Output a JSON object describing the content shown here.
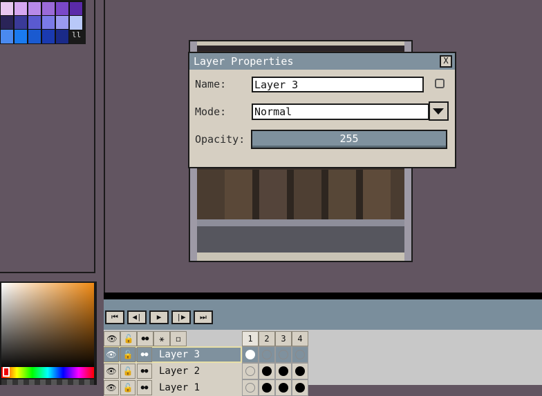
{
  "palette": {
    "colors": [
      [
        "#e8c8f0",
        "#d6a8f0",
        "#b88ae8",
        "#9a6ad8",
        "#7a48c8",
        "#5a2aa8"
      ],
      [
        "#2a2458",
        "#3a3a98",
        "#5a5ad0",
        "#7a7ae8",
        "#9a9af0",
        "#b8c8f8"
      ],
      [
        "#4a8af0",
        "#1a7af0",
        "#1a5ad0",
        "#1a3ab0",
        "#1a2a88",
        "#1a1a1a"
      ]
    ],
    "more_label": "ll"
  },
  "timeline": {
    "buttons": [
      "⏮",
      "◀|",
      "▶",
      "|▶",
      "⏭"
    ],
    "header_icons": [
      "👁",
      "🔓",
      "●●",
      "⚹",
      "◻"
    ],
    "frames": [
      "1",
      "2",
      "3",
      "4"
    ],
    "layers": [
      {
        "name": "Layer 3",
        "active": true,
        "cels": [
          "white",
          "empty",
          "empty",
          "empty"
        ]
      },
      {
        "name": "Layer 2",
        "active": false,
        "cels": [
          "empty",
          "black",
          "black",
          "black"
        ]
      },
      {
        "name": "Layer 1",
        "active": false,
        "cels": [
          "empty",
          "black",
          "black",
          "black"
        ]
      }
    ]
  },
  "dialog": {
    "title": "Layer Properties",
    "close_label": "X",
    "name_label": "Name:",
    "name_value": "Layer 3",
    "mode_label": "Mode:",
    "mode_value": "Normal",
    "opacity_label": "Opacity:",
    "opacity_value": "255"
  },
  "colors": {
    "workspace_bg": "#625561",
    "dialog_bg": "#d6cfc2",
    "dialog_titlebar": "#7f919e"
  }
}
